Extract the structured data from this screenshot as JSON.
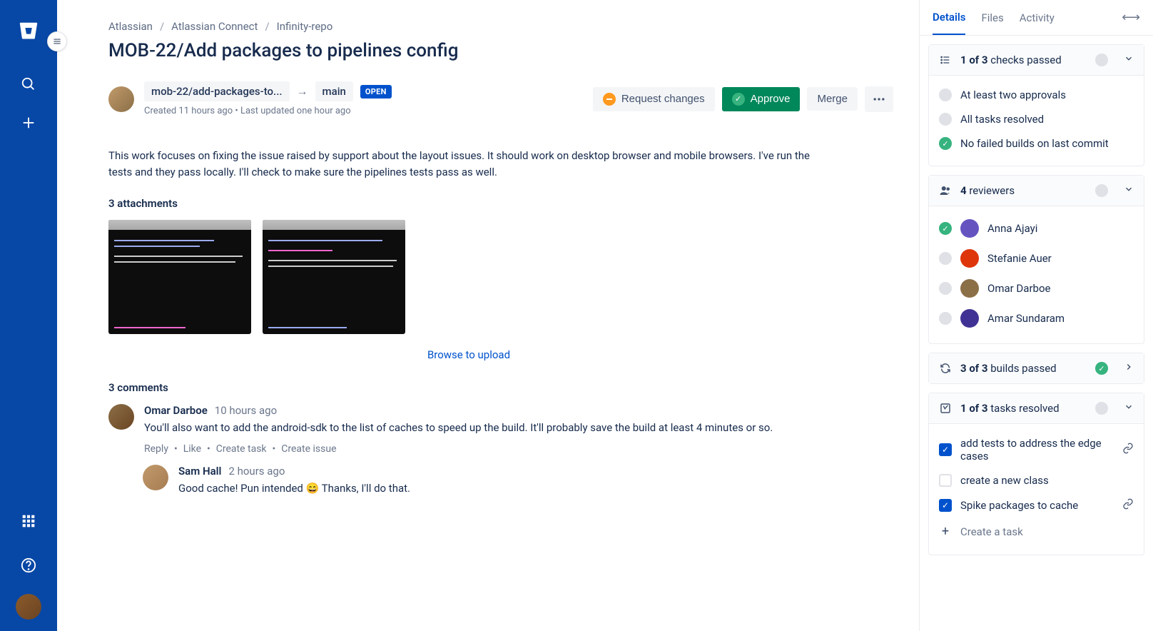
{
  "breadcrumb": {
    "org": "Atlassian",
    "project": "Atlassian Connect",
    "repo": "Infinity-repo"
  },
  "title": "MOB-22/Add packages to pipelines config",
  "pr": {
    "source_branch": "mob-22/add-packages-to...",
    "target_branch": "main",
    "status": "OPEN",
    "meta": "Created 11 hours ago • Last updated one hour ago"
  },
  "actions": {
    "request_changes": "Request changes",
    "approve": "Approve",
    "merge": "Merge"
  },
  "description": "This work focuses on fixing the issue raised by support about the layout issues. It should work on desktop browser and mobile browsers. I've run the tests and they pass locally. I'll check to make sure the pipelines tests pass as well.",
  "attachments_label": "3 attachments",
  "upload_link": "Browse to upload",
  "comments_label": "3 comments",
  "comments": [
    {
      "author": "Omar Darboe",
      "time": "10 hours ago",
      "text": "You'll also want to add the android-sdk to the list of caches to speed up the build. It'll probably save the build at least 4 minutes or so.",
      "actions": [
        "Reply",
        "Like",
        "Create task",
        "Create issue"
      ]
    },
    {
      "author": "Sam Hall",
      "time": "2 hours ago",
      "text": "Good cache! Pun intended 😄 Thanks, I'll do that.",
      "reply": true
    }
  ],
  "sidebar": {
    "tabs": {
      "details": "Details",
      "files": "Files",
      "activity": "Activity"
    },
    "checks": {
      "summary": "1 of 3",
      "summary_suffix": "checks passed",
      "items": [
        {
          "label": "At least two approvals",
          "ok": false
        },
        {
          "label": "All tasks resolved",
          "ok": false
        },
        {
          "label": "No failed builds on last commit",
          "ok": true
        }
      ]
    },
    "reviewers": {
      "count": "4",
      "label": "reviewers",
      "items": [
        {
          "name": "Anna Ajayi",
          "approved": true,
          "color": "#6554c0"
        },
        {
          "name": "Stefanie Auer",
          "approved": false,
          "color": "#de350b"
        },
        {
          "name": "Omar Darboe",
          "approved": false,
          "color": "#8b6f47"
        },
        {
          "name": "Amar Sundaram",
          "approved": false,
          "color": "#403294"
        }
      ]
    },
    "builds": {
      "summary": "3 of 3",
      "summary_suffix": "builds passed"
    },
    "tasks": {
      "summary": "1 of 3",
      "summary_suffix": "tasks resolved",
      "items": [
        {
          "label": "add tests to address the edge cases",
          "done": true,
          "link": true
        },
        {
          "label": "create a new class",
          "done": false,
          "link": false
        },
        {
          "label": "Spike packages to cache",
          "done": true,
          "link": true
        }
      ],
      "create": "Create a task"
    }
  }
}
